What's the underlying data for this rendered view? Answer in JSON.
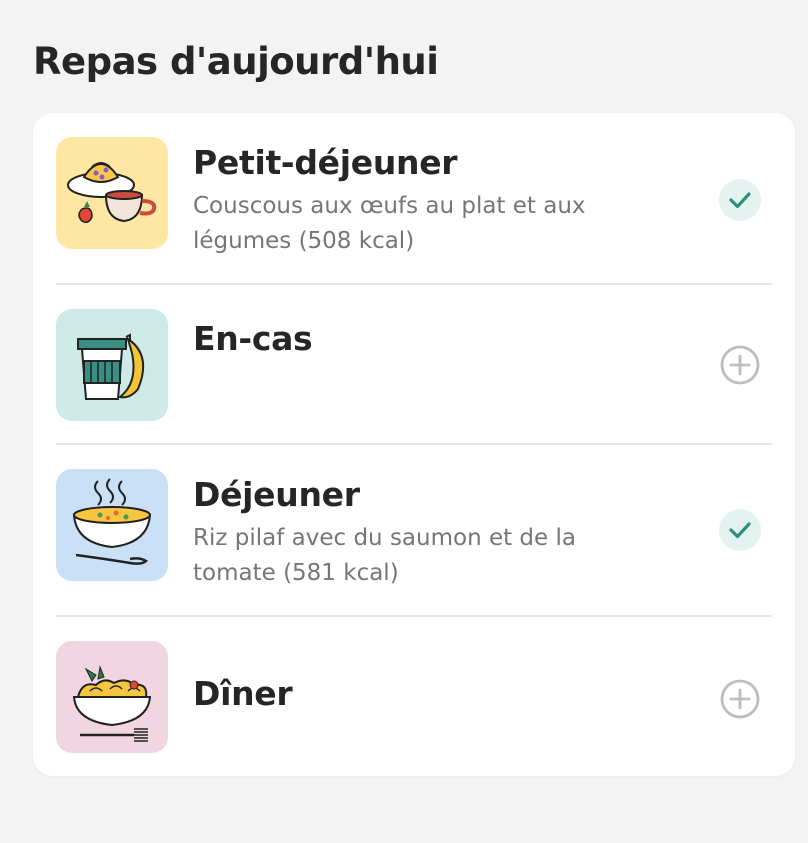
{
  "title": "Repas d'aujourd'hui",
  "colors": {
    "breakfast_tile": "#fde7a3",
    "snack_tile": "#cdeae6",
    "lunch_tile": "#c9e0f6",
    "dinner_tile": "#f1d6e2",
    "check_accent": "#2f8f7c",
    "plus_gray": "#bdbdbd"
  },
  "meals": [
    {
      "name": "Petit-déjeuner",
      "description": "Couscous aux œufs au plat et aux légumes (508 kcal)",
      "status": "done",
      "icon": "croissant-coffee-icon",
      "action_icon": "check-icon"
    },
    {
      "name": "En-cas",
      "description": "",
      "status": "empty",
      "icon": "cup-banana-icon",
      "action_icon": "plus-circle-icon"
    },
    {
      "name": "Déjeuner",
      "description": "Riz pilaf avec du saumon et de la tomate (581 kcal)",
      "status": "done",
      "icon": "soup-bowl-icon",
      "action_icon": "check-icon"
    },
    {
      "name": "Dîner",
      "description": "",
      "status": "empty",
      "icon": "pasta-bowl-icon",
      "action_icon": "plus-circle-icon"
    }
  ]
}
